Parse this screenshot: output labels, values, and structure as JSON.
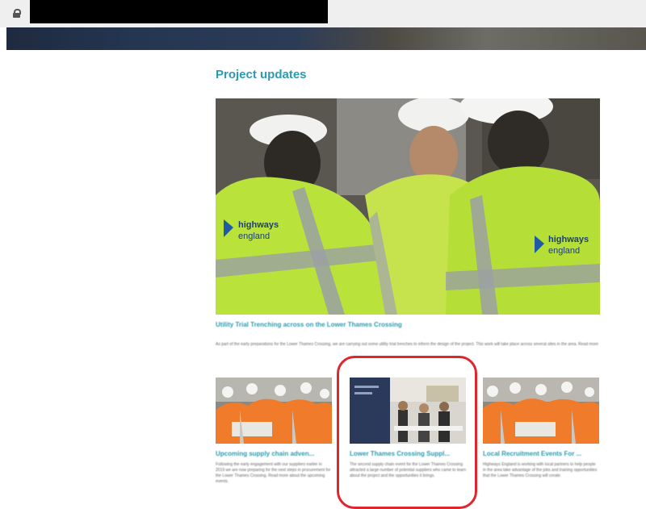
{
  "browser": {
    "lock_icon": "lock-icon",
    "url_redacted": true
  },
  "colors": {
    "accent": "#2a9bb0",
    "highlight": "#e0252b",
    "hi_vis_yellow": "#b9e23a",
    "hi_vis_orange": "#f07b2a"
  },
  "section": {
    "title": "Project updates"
  },
  "feature": {
    "image_alt": "Highways England workers in hi-vis jackets",
    "jacket_logo": "highways england",
    "headline": "Utility Trial Trenching across on the Lower Thames Crossing",
    "excerpt": "As part of the early preparations for the Lower Thames Crossing, we are carrying out some utility trial trenches to inform the design of the project. This work will take place across several sites in the area. Read more"
  },
  "cards": [
    {
      "title": "Upcoming supply chain adven...",
      "date": "",
      "excerpt": "Following the early engagement with our suppliers earlier in 2019 we are now preparing for the next steps in procurement for the Lower Thames Crossing. Read more about the upcoming events."
    },
    {
      "title": "Lower Thames Crossing Suppl...",
      "date": "",
      "excerpt": "The second supply chain event for the Lower Thames Crossing attracted a large number of potential suppliers who came to learn about the project and the opportunities it brings."
    },
    {
      "title": "Local Recruitment Events For ...",
      "date": "",
      "excerpt": "Highways England is working with local partners to help people in the area take advantage of the jobs and training opportunities that the Lower Thames Crossing will create."
    }
  ]
}
